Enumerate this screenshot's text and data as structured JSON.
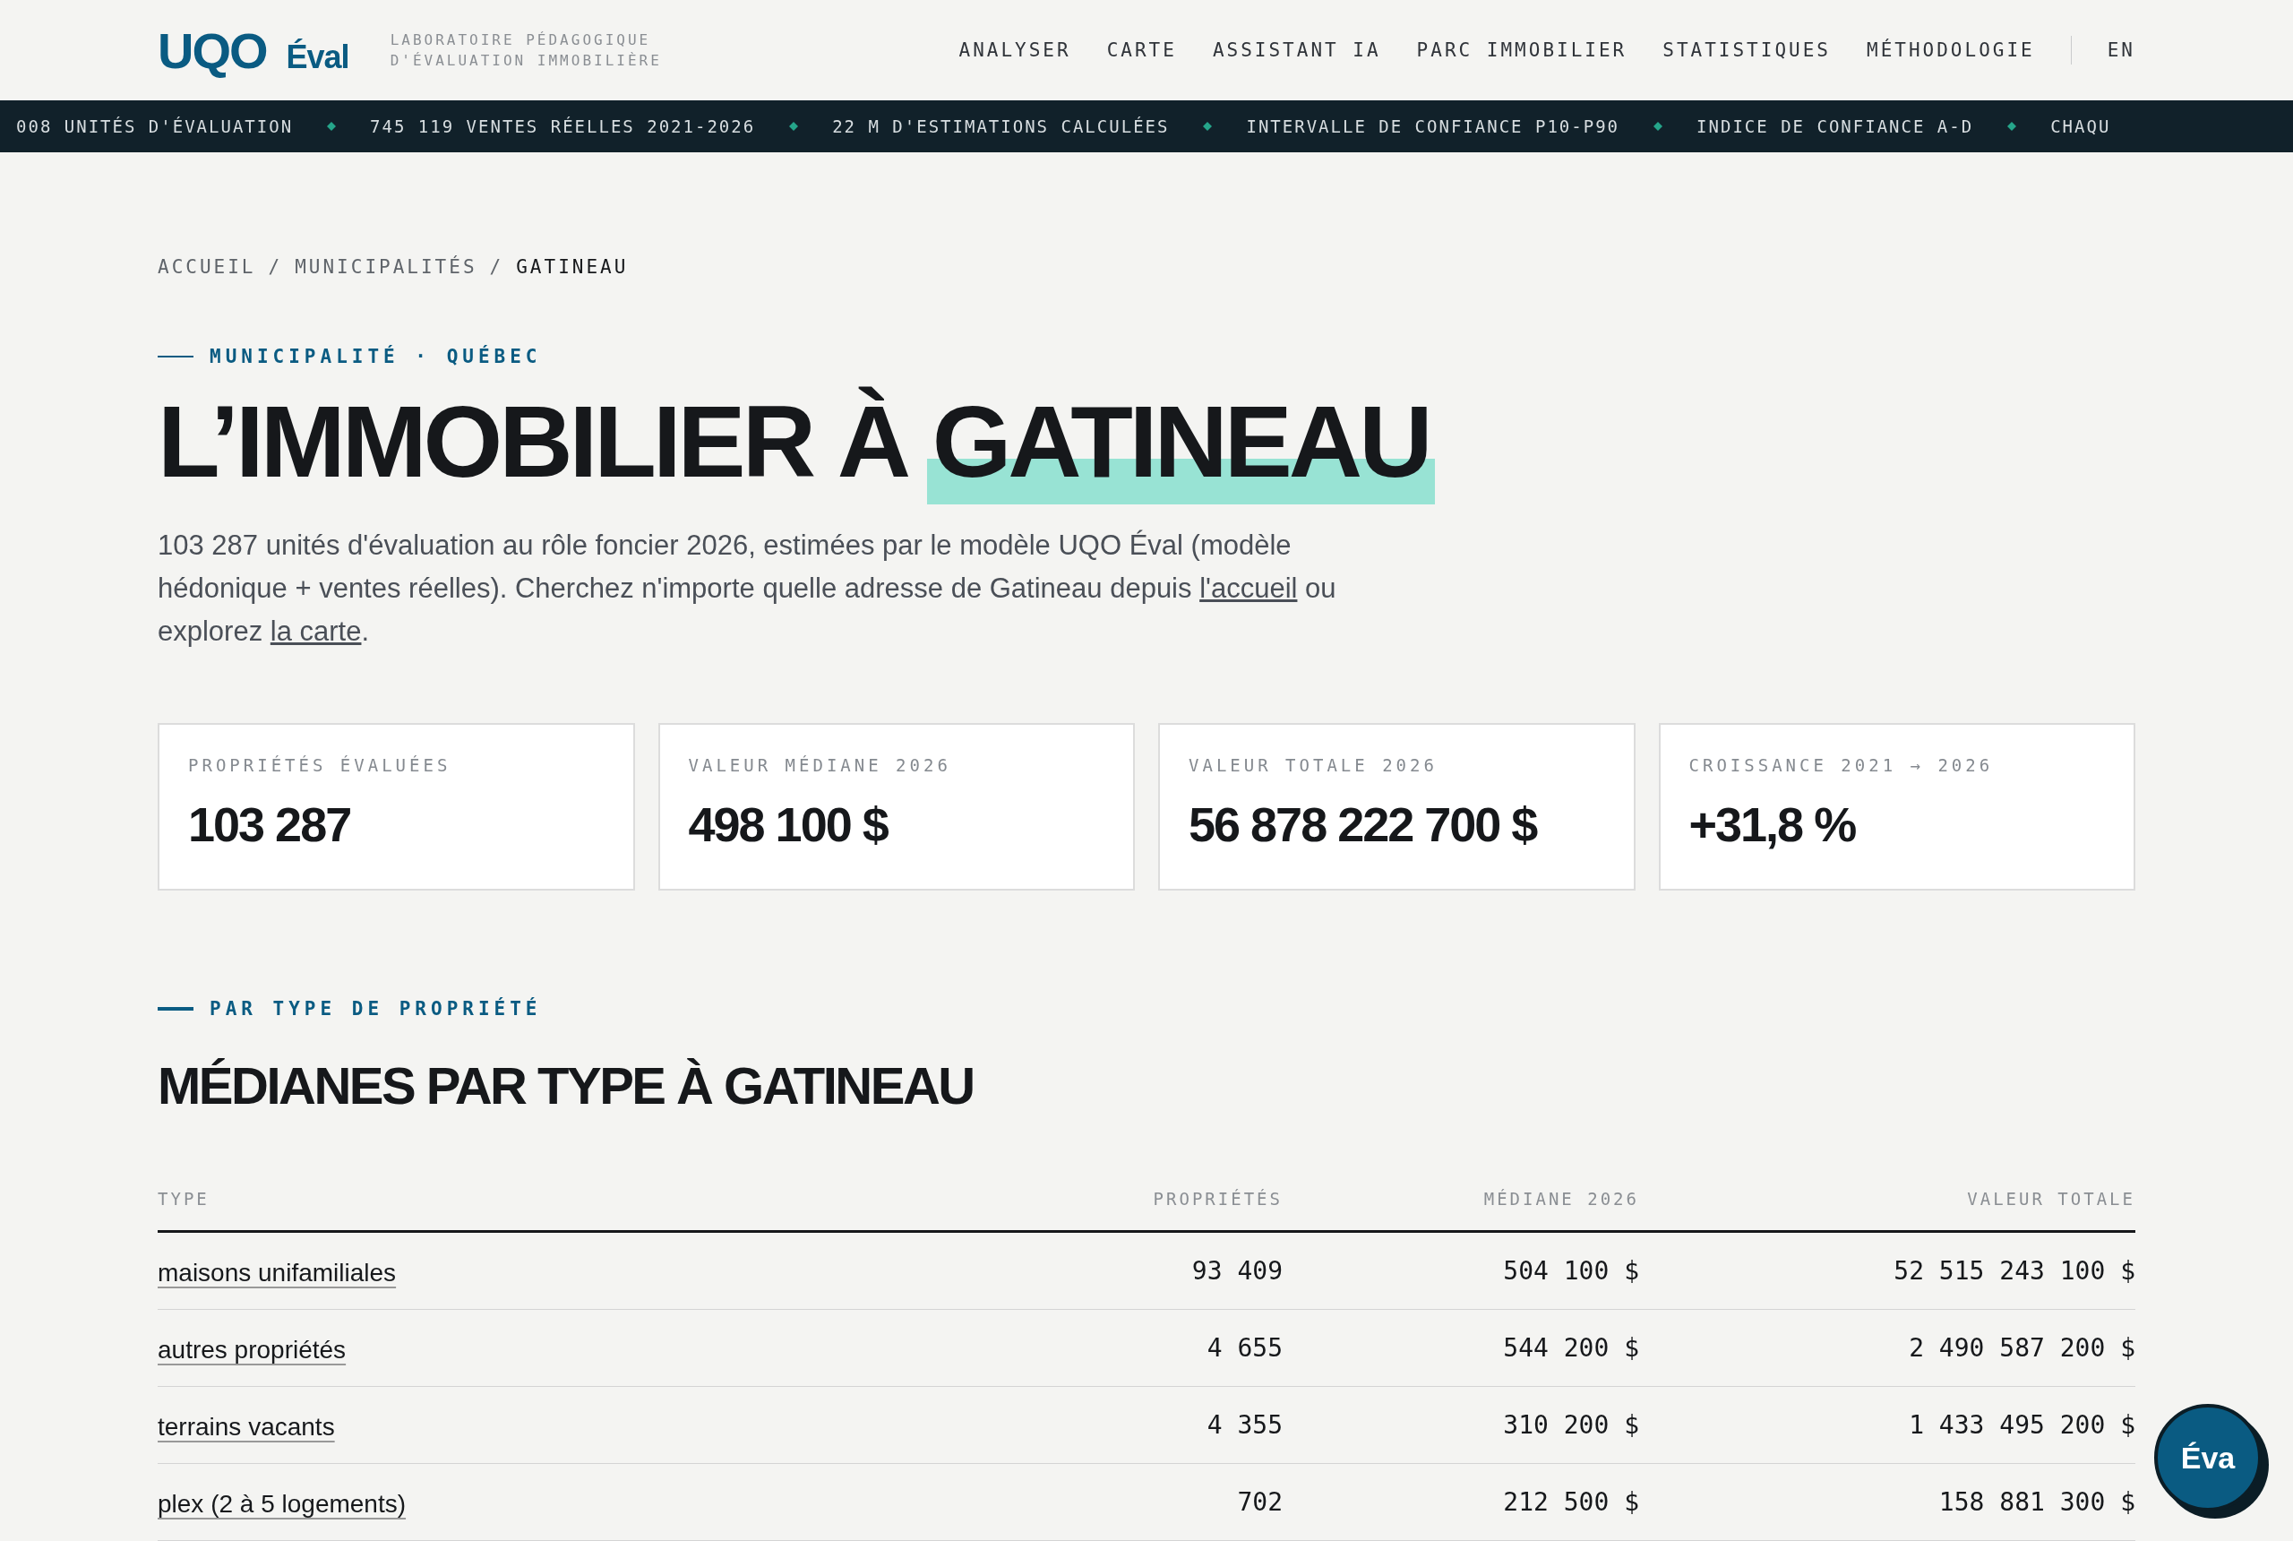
{
  "header": {
    "logo": {
      "mark": "UQO",
      "name": "Éval"
    },
    "tagline": [
      "LABORATOIRE PÉDAGOGIQUE",
      "D'ÉVALUATION IMMOBILIÈRE"
    ],
    "nav": [
      "ANALYSER",
      "CARTE",
      "ASSISTANT IA",
      "PARC IMMOBILIER",
      "STATISTIQUES",
      "MÉTHODOLOGIE"
    ],
    "language": "EN"
  },
  "ticker": [
    "008 UNITÉS D'ÉVALUATION",
    "745 119 VENTES RÉELLES 2021-2026",
    "22 M D'ESTIMATIONS CALCULÉES",
    "INTERVALLE DE CONFIANCE P10-P90",
    "INDICE DE CONFIANCE A-D",
    "CHAQU"
  ],
  "breadcrumb_separator": "/",
  "breadcrumb": [
    {
      "label": "ACCUEIL",
      "current": false
    },
    {
      "label": "MUNICIPALITÉS",
      "current": false
    },
    {
      "label": "GATINEAU",
      "current": true
    }
  ],
  "hero": {
    "eyebrow": "MUNICIPALITÉ · QUÉBEC",
    "title": "L’IMMOBILIER À",
    "title_highlight": "GATINEAU",
    "intro": [
      {
        "kind": "text",
        "text": "103 287 unités d'évaluation au rôle foncier 2026, estimées par le modèle UQO Éval (modèle hédonique + ventes réelles). Cherchez n'importe quelle adresse de Gatineau depuis "
      },
      {
        "kind": "link",
        "text": "l'accueil"
      },
      {
        "kind": "text",
        "text": " ou explorez "
      },
      {
        "kind": "link",
        "text": "la carte"
      },
      {
        "kind": "text",
        "text": "."
      }
    ]
  },
  "stats": [
    {
      "label": "PROPRIÉTÉS ÉVALUÉES",
      "value": "103 287"
    },
    {
      "label": "VALEUR MÉDIANE 2026",
      "value": "498 100 $"
    },
    {
      "label": "VALEUR TOTALE 2026",
      "value": "56 878 222 700 $"
    },
    {
      "label": "CROISSANCE 2021 → 2026",
      "value": "+31,8 %"
    }
  ],
  "section": {
    "eyebrow": "PAR TYPE DE PROPRIÉTÉ",
    "title": "MÉDIANES PAR TYPE À GATINEAU"
  },
  "table": {
    "columns": [
      "TYPE",
      "PROPRIÉTÉS",
      "MÉDIANE 2026",
      "VALEUR TOTALE"
    ],
    "rows": [
      {
        "type": "maisons unifamiliales",
        "properties": "93 409",
        "median": "504 100 $",
        "total": "52 515 243 100 $"
      },
      {
        "type": "autres propriétés",
        "properties": "4 655",
        "median": "544 200 $",
        "total": "2 490 587 200 $"
      },
      {
        "type": "terrains vacants",
        "properties": "4 355",
        "median": "310 200 $",
        "total": "1 433 495 200 $"
      },
      {
        "type": "plex (2 à 5 logements)",
        "properties": "702",
        "median": "212 500 $",
        "total": "158 881 300 $"
      }
    ]
  },
  "assistant_button": "Éva"
}
